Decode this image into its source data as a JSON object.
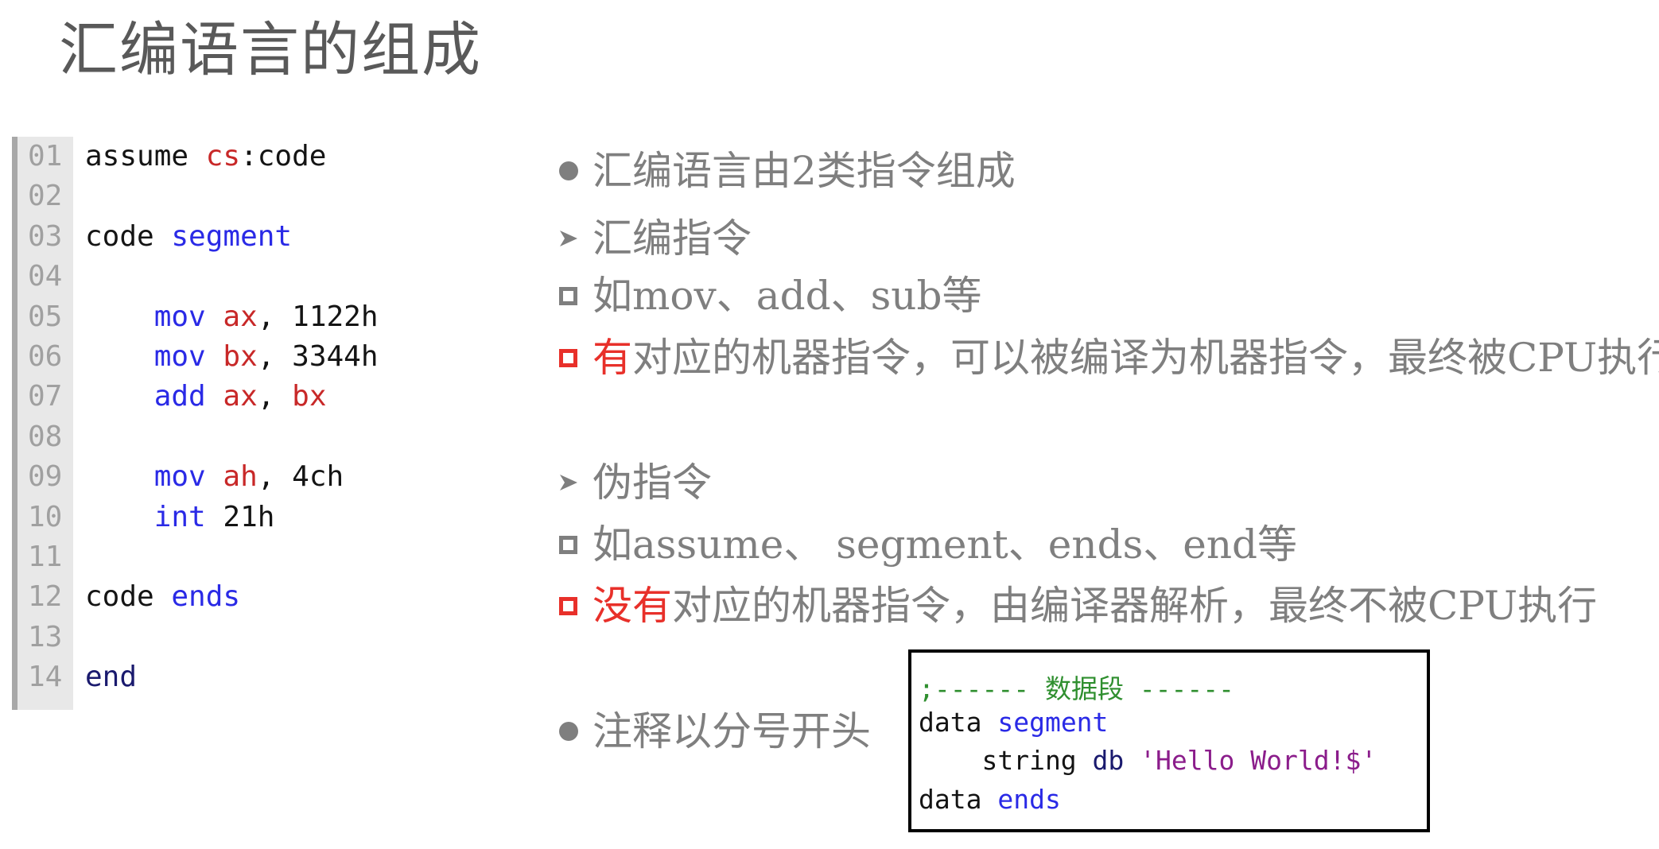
{
  "title": "汇编语言的组成",
  "code_listing": {
    "lines": [
      {
        "no": "01",
        "tokens": [
          {
            "t": "assume ",
            "c": "plain"
          },
          {
            "t": "cs",
            "c": "reg"
          },
          {
            "t": ":code",
            "c": "plain"
          }
        ]
      },
      {
        "no": "02",
        "tokens": []
      },
      {
        "no": "03",
        "tokens": [
          {
            "t": "code ",
            "c": "plain"
          },
          {
            "t": "segment",
            "c": "kw"
          }
        ]
      },
      {
        "no": "04",
        "tokens": []
      },
      {
        "no": "05",
        "tokens": [
          {
            "t": "    ",
            "c": "plain"
          },
          {
            "t": "mov",
            "c": "kw"
          },
          {
            "t": " ",
            "c": "plain"
          },
          {
            "t": "ax",
            "c": "reg"
          },
          {
            "t": ", ",
            "c": "plain"
          },
          {
            "t": "1122h",
            "c": "num"
          }
        ]
      },
      {
        "no": "06",
        "tokens": [
          {
            "t": "    ",
            "c": "plain"
          },
          {
            "t": "mov",
            "c": "kw"
          },
          {
            "t": " ",
            "c": "plain"
          },
          {
            "t": "bx",
            "c": "reg"
          },
          {
            "t": ", ",
            "c": "plain"
          },
          {
            "t": "3344h",
            "c": "num"
          }
        ]
      },
      {
        "no": "07",
        "tokens": [
          {
            "t": "    ",
            "c": "plain"
          },
          {
            "t": "add",
            "c": "kw"
          },
          {
            "t": " ",
            "c": "plain"
          },
          {
            "t": "ax",
            "c": "reg"
          },
          {
            "t": ", ",
            "c": "plain"
          },
          {
            "t": "bx",
            "c": "reg"
          }
        ]
      },
      {
        "no": "08",
        "tokens": []
      },
      {
        "no": "09",
        "tokens": [
          {
            "t": "    ",
            "c": "plain"
          },
          {
            "t": "mov",
            "c": "kw"
          },
          {
            "t": " ",
            "c": "plain"
          },
          {
            "t": "ah",
            "c": "reg"
          },
          {
            "t": ", ",
            "c": "plain"
          },
          {
            "t": "4ch",
            "c": "num"
          }
        ]
      },
      {
        "no": "10",
        "tokens": [
          {
            "t": "    ",
            "c": "plain"
          },
          {
            "t": "int",
            "c": "kw"
          },
          {
            "t": " ",
            "c": "plain"
          },
          {
            "t": "21h",
            "c": "num"
          }
        ]
      },
      {
        "no": "11",
        "tokens": []
      },
      {
        "no": "12",
        "tokens": [
          {
            "t": "code ",
            "c": "plain"
          },
          {
            "t": "ends",
            "c": "kw"
          }
        ]
      },
      {
        "no": "13",
        "tokens": []
      },
      {
        "no": "14",
        "tokens": [
          {
            "t": "end",
            "c": "dir"
          }
        ]
      }
    ]
  },
  "bullets": [
    {
      "marker": "dot-icon",
      "red": "",
      "text": "汇编语言由2类指令组成"
    },
    {
      "marker": "arrow-icon",
      "red": "",
      "text": "汇编指令"
    },
    {
      "marker": "square-icon",
      "red": "",
      "text": "如mov、add、sub等"
    },
    {
      "marker": "red-square-icon",
      "red": "有",
      "text": "对应的机器指令，可以被编译为机器指令，最终被CPU执行"
    },
    {
      "marker": "arrow-icon",
      "red": "",
      "text": "伪指令"
    },
    {
      "marker": "square-icon",
      "red": "",
      "text": "如assume、 segment、ends、end等"
    },
    {
      "marker": "red-square-icon",
      "red": "没有",
      "text": "对应的机器指令，由编译器解析，最终不被CPU执行"
    },
    {
      "marker": "dot-icon",
      "red": "",
      "text": "注释以分号开头"
    }
  ],
  "snippet": {
    "lines": [
      [
        {
          "t": ";------ 数据段 ------",
          "c": "cmt"
        }
      ],
      [
        {
          "t": "data ",
          "c": "plain"
        },
        {
          "t": "segment",
          "c": "kw"
        }
      ],
      [
        {
          "t": "    string ",
          "c": "plain"
        },
        {
          "t": "db",
          "c": "dir"
        },
        {
          "t": " ",
          "c": "plain"
        },
        {
          "t": "'Hello World!$'",
          "c": "str"
        }
      ],
      [
        {
          "t": "data ",
          "c": "plain"
        },
        {
          "t": "ends",
          "c": "kw"
        }
      ]
    ]
  },
  "colors": {
    "title": "#595959",
    "body_text": "#7f7f7f",
    "accent_red": "#e8302a",
    "keyword_blue": "#2a2ae6",
    "register_red": "#c82828",
    "comment_green": "#2f8f2f",
    "string_purple": "#8b1d8b"
  }
}
